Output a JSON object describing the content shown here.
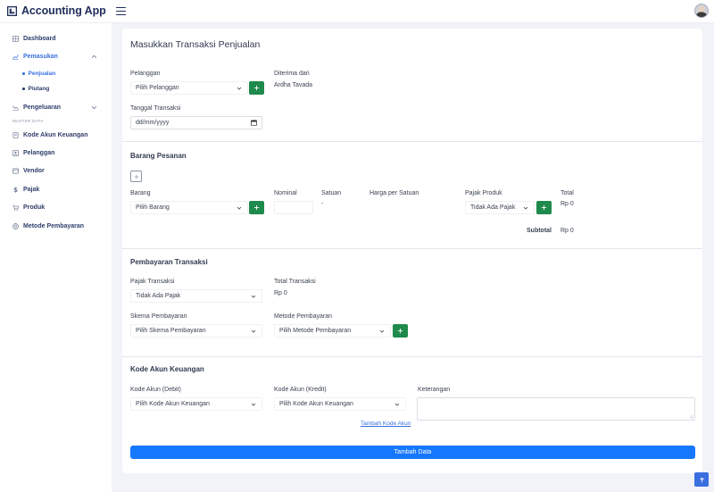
{
  "app": {
    "title": "Accounting App"
  },
  "colors": {
    "primary": "#1677ff",
    "success": "#1e8a4c",
    "nav_active": "#3a6fe0",
    "nav_text": "#2e3d6b"
  },
  "sidebar": {
    "section_label": "MASTER DATA",
    "items": [
      {
        "label": "Dashboard",
        "icon": "grid-icon"
      },
      {
        "label": "Pemasukan",
        "icon": "chart-up-icon",
        "expanded": true
      },
      {
        "label": "Penjualan",
        "sub": true,
        "active": true
      },
      {
        "label": "Piutang",
        "sub": true
      },
      {
        "label": "Pengeluaran",
        "icon": "chart-down-icon"
      },
      {
        "label": "Kode Akun Keuangan",
        "icon": "book-icon"
      },
      {
        "label": "Pelanggan",
        "icon": "contact-icon"
      },
      {
        "label": "Vendor",
        "icon": "card-icon"
      },
      {
        "label": "Pajak",
        "icon": "dollar-icon"
      },
      {
        "label": "Produk",
        "icon": "cart-icon"
      },
      {
        "label": "Metode Pembayaran",
        "icon": "coin-icon"
      }
    ]
  },
  "form": {
    "title": "Masukkan Transaksi Penjualan",
    "pelanggan": {
      "label": "Pelanggan",
      "value": "Pilih Pelanggan"
    },
    "diterima": {
      "label": "Diterima dari",
      "value": "Ardha Tavada"
    },
    "tanggal": {
      "label": "Tanggal Transaksi",
      "placeholder": "dd/mm/yyyy"
    },
    "barang": {
      "section": "Barang Pesanan",
      "col_barang": "Barang",
      "col_nominal": "Nominal",
      "col_satuan": "Satuan",
      "col_harga": "Harga per Satuan",
      "col_pajak": "Pajak Produk",
      "col_total": "Total",
      "barang_value": "Pilih Barang",
      "satuan_value": "-",
      "pajak_value": "Tidak Ada Pajak",
      "total_value": "Rp 0",
      "subtotal_label": "Subtotal",
      "subtotal_value": "Rp 0"
    },
    "pembayaran": {
      "section": "Pembayaran Transaksi",
      "pajak_label": "Pajak Transaksi",
      "pajak_value": "Tidak Ada Pajak",
      "total_label": "Total Transaksi",
      "total_value": "Rp 0",
      "skema_label": "Skema Pembayaran",
      "skema_value": "Pilih Skema Pembayaran",
      "metode_label": "Metode Pembayaran",
      "metode_value": "Pilih Metode Pembayaran"
    },
    "akun": {
      "section": "Kode Akun Keuangan",
      "debit_label": "Kode Akun (Debit)",
      "debit_value": "Pilih Kode Akun Keuangan",
      "kredit_label": "Kode Akun (Kredit)",
      "kredit_value": "Pilih Kode Akun Keuangan",
      "keterangan_label": "Keterangan",
      "tambah_link": "Tambah Kode Akun"
    },
    "submit_label": "Tambah Data"
  }
}
